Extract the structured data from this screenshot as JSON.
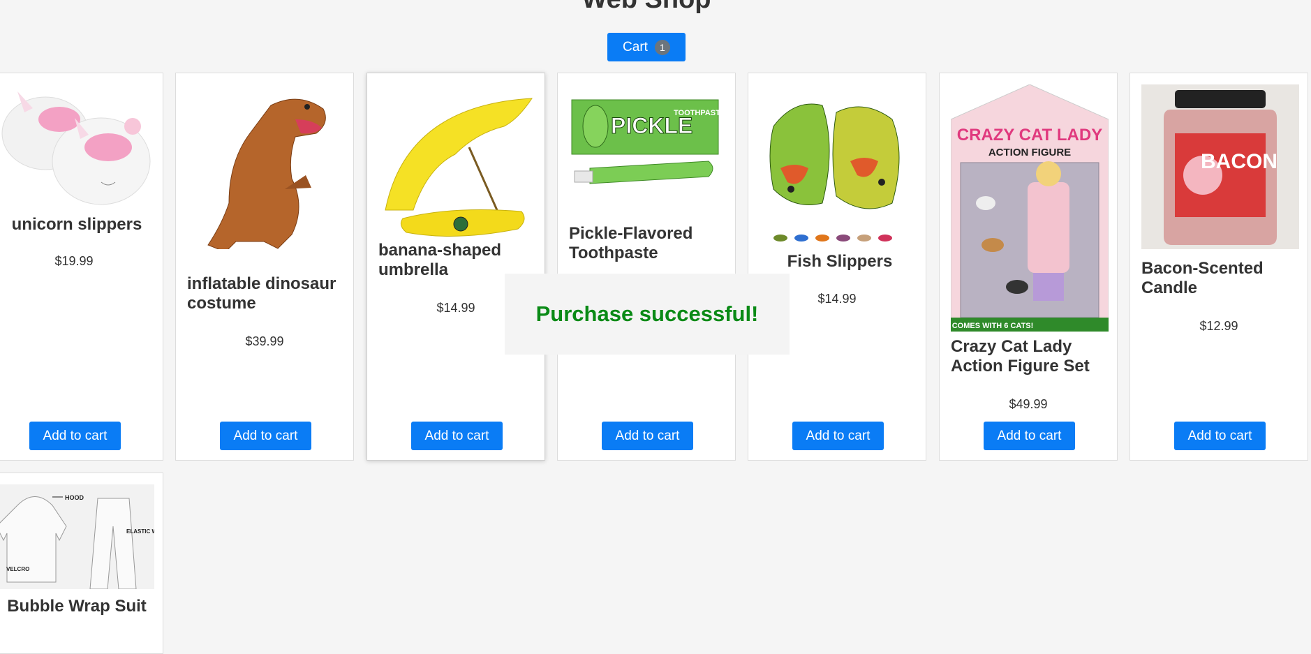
{
  "header": {
    "title": "Web Shop"
  },
  "cart": {
    "label": "Cart",
    "count": "1"
  },
  "notification": {
    "message": "Purchase successful!",
    "color": "#0a8a16"
  },
  "accent_color": "#0a7cf5",
  "products": [
    {
      "name": "unicorn slippers",
      "price": "$19.99",
      "button": "Add to cart",
      "image_icon": "unicorn-slippers-image"
    },
    {
      "name": "inflatable dinosaur costume",
      "price": "$39.99",
      "button": "Add to cart",
      "image_icon": "dinosaur-costume-image"
    },
    {
      "name": "banana-shaped umbrella",
      "price": "$14.99",
      "button": "Add to cart",
      "image_icon": "banana-umbrella-image"
    },
    {
      "name": "Pickle-Flavored Toothpaste",
      "price": "",
      "button": "Add to cart",
      "image_icon": "pickle-toothpaste-image",
      "image_text": {
        "brand": "PICKLE",
        "sub": "TOOTHPASTE"
      }
    },
    {
      "name": "Fish Slippers",
      "price": "$14.99",
      "button": "Add to cart",
      "image_icon": "fish-slippers-image"
    },
    {
      "name": "Crazy Cat Lady Action Figure Set",
      "price": "$49.99",
      "button": "Add to cart",
      "image_icon": "crazy-cat-lady-image",
      "image_text": {
        "title": "CRAZY CAT LADY",
        "sub": "ACTION FIGURE",
        "footer": "COMES WITH 6 CATS!"
      }
    },
    {
      "name": "Bacon-Scented Candle",
      "price": "$12.99",
      "button": "Add to cart",
      "image_icon": "bacon-candle-image",
      "image_text": {
        "label": "BACON"
      }
    },
    {
      "name": "Bubble Wrap Suit",
      "price": "",
      "button": "",
      "image_icon": "bubble-wrap-suit-image",
      "image_text": {
        "hood": "HOOD",
        "waist": "ELASTIC WAIST",
        "velcro": "VELCRO"
      }
    }
  ]
}
